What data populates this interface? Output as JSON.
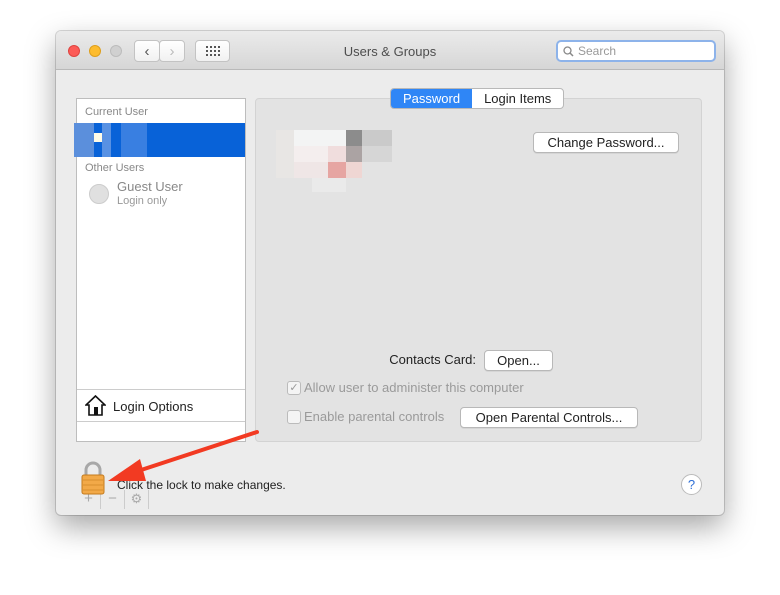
{
  "window": {
    "title": "Users & Groups",
    "search_placeholder": "Search"
  },
  "sidebar": {
    "current_user_header": "Current User",
    "other_users_header": "Other Users",
    "guest": {
      "name": "Guest User",
      "subtitle": "Login only"
    },
    "login_options": "Login Options",
    "add": "+",
    "remove": "−"
  },
  "tabs": [
    {
      "label": "Password",
      "selected": true
    },
    {
      "label": "Login Items",
      "selected": false
    }
  ],
  "main": {
    "change_password": "Change Password...",
    "contacts_card_label": "Contacts Card:",
    "open_button": "Open...",
    "allow_admin": {
      "label": "Allow user to administer this computer",
      "checked": true,
      "check_glyph": "✓"
    },
    "parental": {
      "label": "Enable parental controls",
      "checked": false
    },
    "open_parental": "Open Parental Controls..."
  },
  "footer": {
    "lock_text": "Click the lock to make changes.",
    "help": "?"
  },
  "colors": {
    "selection": "#0862d8",
    "tab_selected": "#2f86f6",
    "annotation_arrow": "#f23a22"
  }
}
